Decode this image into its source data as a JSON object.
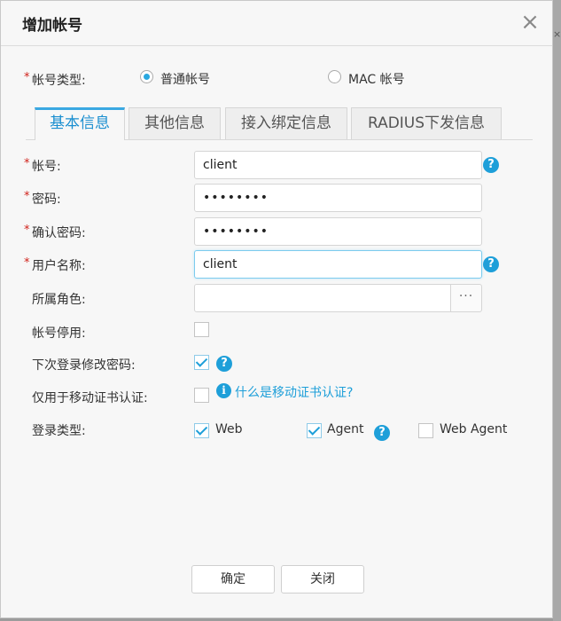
{
  "dialog": {
    "title": "增加帐号",
    "close_icon": "close-icon",
    "backdrop_fragment": "×"
  },
  "account_type": {
    "label": "帐号类型:",
    "options": [
      {
        "label": "普通帐号",
        "selected": true
      },
      {
        "label": "MAC 帐号",
        "selected": false
      }
    ]
  },
  "tabs": [
    {
      "label": "基本信息",
      "active": true
    },
    {
      "label": "其他信息",
      "active": false
    },
    {
      "label": "接入绑定信息",
      "active": false
    },
    {
      "label": "RADIUS下发信息",
      "active": false
    }
  ],
  "required_mark": "*",
  "fields": {
    "account": {
      "label": "帐号:",
      "value": "client"
    },
    "password": {
      "label": "密码:",
      "value": "••••••••"
    },
    "confirm_password": {
      "label": "确认密码:",
      "value": "••••••••"
    },
    "username": {
      "label": "用户名称:",
      "value": "client"
    },
    "role": {
      "label": "所属角色:",
      "value": "",
      "button": "···"
    },
    "disabled": {
      "label": "帐号停用:",
      "checked": false
    },
    "change_pwd": {
      "label": "下次登录修改密码:",
      "checked": true
    },
    "mobile_cert": {
      "label": "仅用于移动证书认证:",
      "checked": false,
      "link": "什么是移动证书认证?"
    },
    "login_type": {
      "label": "登录类型:",
      "options": [
        {
          "label": "Web",
          "checked": true
        },
        {
          "label": "Agent",
          "checked": true
        },
        {
          "label": "Web Agent",
          "checked": false
        }
      ]
    }
  },
  "help_glyph": "?",
  "info_glyph": "i",
  "buttons": {
    "ok": "确定",
    "close": "关闭"
  },
  "colors": {
    "accent": "#1e9fd9",
    "required": "#d0211a"
  }
}
